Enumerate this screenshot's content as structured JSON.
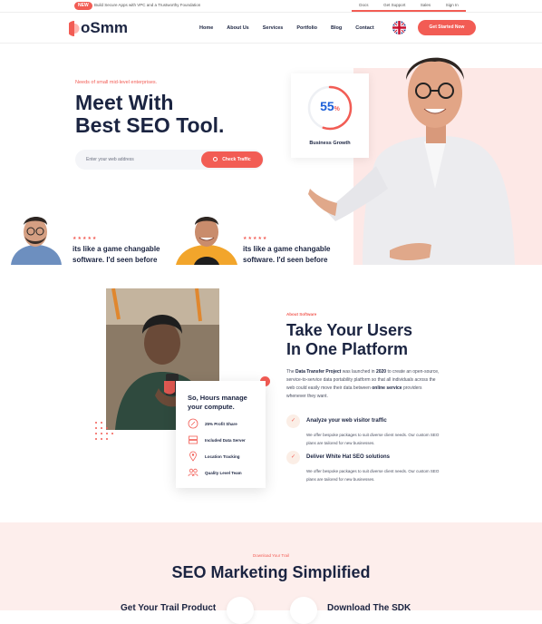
{
  "topbar": {
    "badge": "NEW",
    "note": "Build Secure Apps with VPC and a Trustworthy Foundation",
    "links": [
      "Docs",
      "Get Support",
      "Sales",
      "Sign In"
    ]
  },
  "header": {
    "logo": "oSmm",
    "nav": [
      "Home",
      "About Us",
      "Services",
      "Portfolio",
      "Blog",
      "Contact"
    ],
    "cta": "Get Started Now"
  },
  "hero": {
    "tagline": "Needs of small mid-level enterprises.",
    "title_line1": "Meet With",
    "title_line2": "Best SEO Tool.",
    "search_placeholder": "Enter your web address",
    "search_button": "Check Traffic",
    "growth_value": "55",
    "growth_unit": "%",
    "growth_progress": 0.55,
    "growth_label": "Business Growth",
    "testimonials": [
      {
        "stars": "★★★★★",
        "line1": "its like a game changable",
        "line2": "software. I'd seen before"
      },
      {
        "stars": "★★★★★",
        "line1": "its like a game changable",
        "line2": "software. I'd seen before"
      }
    ]
  },
  "about": {
    "compute_title_1": "So, Hours manage",
    "compute_title_2": "your compute.",
    "compute_items": [
      "25% Profit Share",
      "Included Data Server",
      "Location Tracking",
      "Quality Level Team"
    ],
    "tag": "About Software",
    "title_line1": "Take Your Users",
    "title_line2": "In One Platform",
    "para_1": "The ",
    "para_b1": "Data Transfer Project",
    "para_2": " was launched in ",
    "para_b2": "2020",
    "para_3": " to create an open-source, service-to-service data portability platform so that all individuals across the web could easily move their data between ",
    "para_b3": "online service",
    "para_4": " providers whenever they want.",
    "features": [
      {
        "title": "Analyze your web visitor traffic",
        "desc": "We offer bespoke packages to suit diverse client needs. Our custom SEO plans are tailored for new businesses."
      },
      {
        "title": "Deliver White Hat SEO solutions",
        "desc": "We offer bespoke packages to suit diverse client needs. Our custom SEO plans are tailored for new businesses."
      }
    ]
  },
  "download": {
    "tag": "Download Your Trail",
    "title": "SEO Marketing Simplified",
    "items": [
      "Get Your Trail Product",
      "Download The SDK"
    ]
  },
  "colors": {
    "accent": "#f25c54",
    "navy": "#1b2441",
    "pink": "#fde8e6"
  }
}
